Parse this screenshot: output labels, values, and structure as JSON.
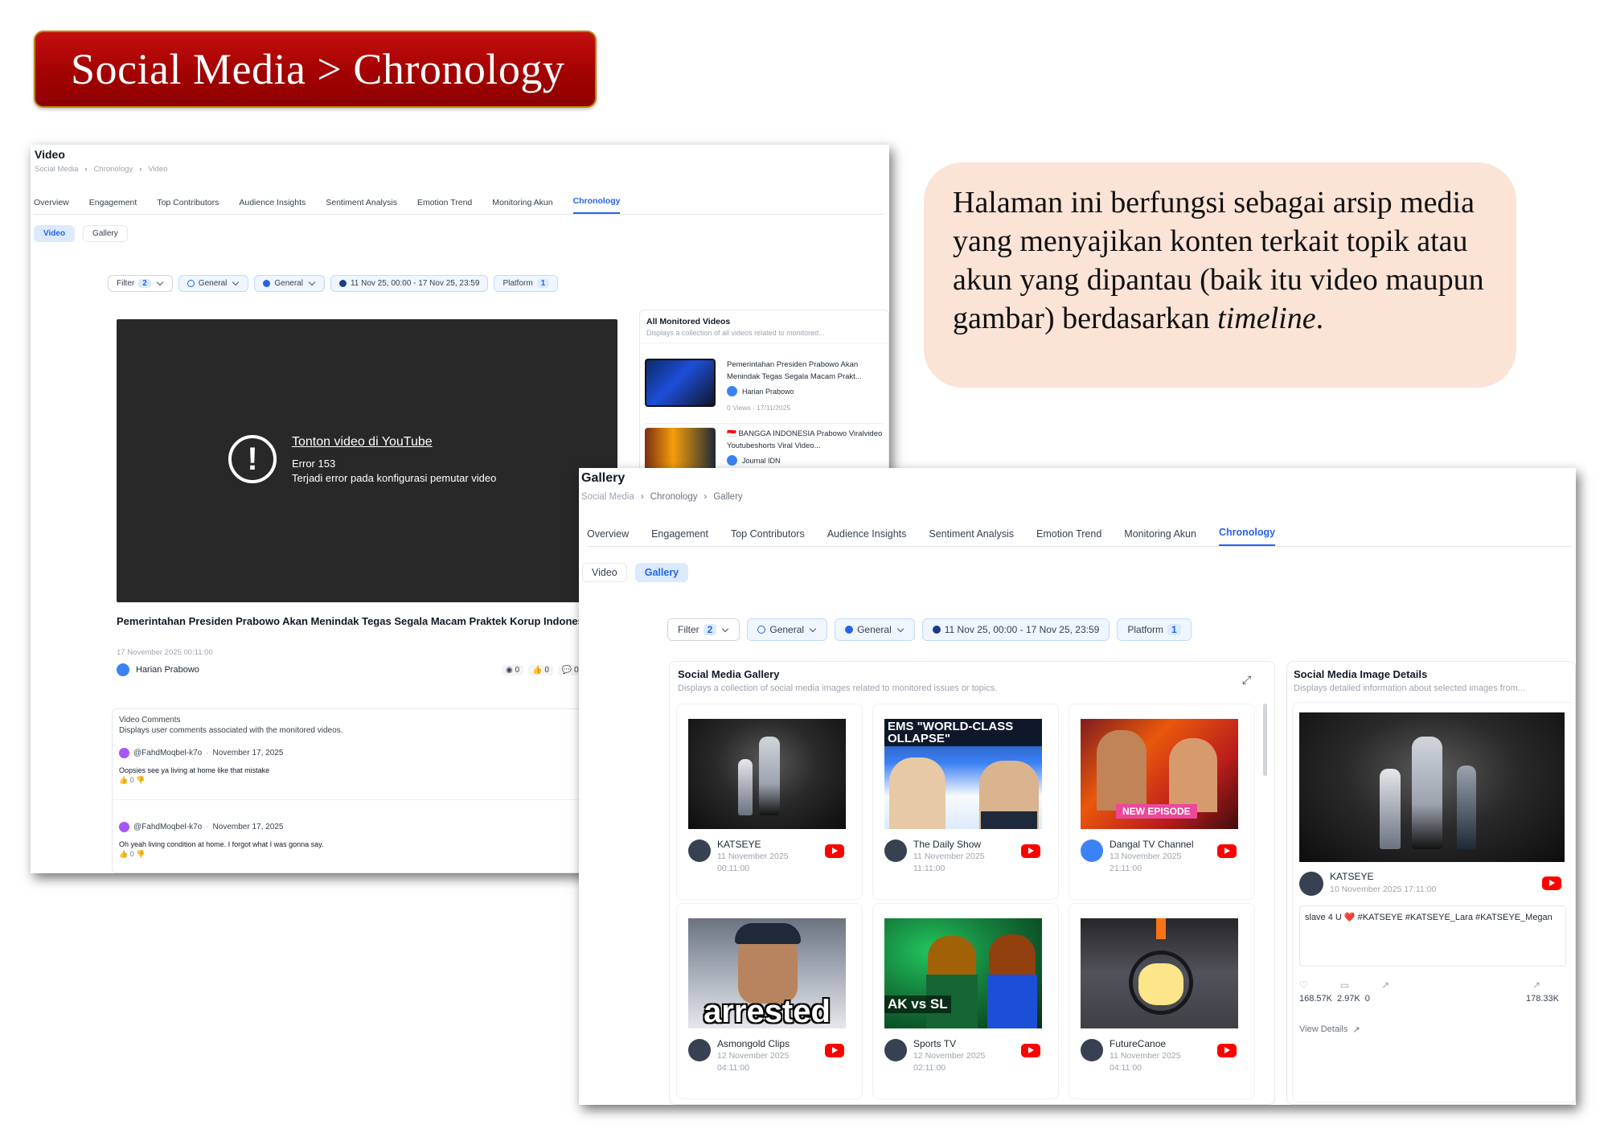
{
  "slide": {
    "title": "Social Media > Chronology",
    "description_main": "Halaman ini berfungsi sebagai arsip media yang menyajikan konten terkait topik atau akun yang dipantau (baik itu video maupun gambar) berdasarkan ",
    "description_italic": "timeline",
    "description_end": "."
  },
  "video_page": {
    "title": "Video",
    "breadcrumb": [
      "Social Media",
      "Chronology",
      "Video"
    ],
    "tabs": [
      "Overview",
      "Engagement",
      "Top Contributors",
      "Audience Insights",
      "Sentiment Analysis",
      "Emotion Trend",
      "Monitoring Akun",
      "Chronology"
    ],
    "subtabs": [
      "Video",
      "Gallery"
    ],
    "filters": {
      "filter_label": "Filter",
      "filter_count": "2",
      "general_1": "General",
      "general_2": "General",
      "date_range": "11 Nov 25, 00:00 - 17 Nov 25, 23:59",
      "platform_label": "Platform",
      "platform_count": "1"
    },
    "player": {
      "link": "Tonton video di YouTube",
      "error_code": "Error 153",
      "error_msg": "Terjadi error pada konfigurasi pemutar video"
    },
    "video_title": "Pemerintahan Presiden Prabowo Akan Menindak Tegas Segala Macam Praktek Korup Indonesia",
    "video_date": "17 November 2025 00:11:00",
    "video_channel": "Harian Prabowo",
    "video_stats": {
      "views": "0",
      "likes": "0",
      "dislikes": "0"
    },
    "list": {
      "title": "All Monitored Videos",
      "subtitle": "Displays a collection of all videos related to monitored...",
      "items": [
        {
          "title": "Pemerintahan Presiden Prabowo Akan Menindak Tegas Segala Macam Prakt...",
          "channel": "Harian Prabowo",
          "stats": "0 Views · 17/11/2025"
        },
        {
          "title": "🇮🇩 BANGGA INDONESIA Prabowo Viralvideo Youtubeshorts Viral Video...",
          "channel": "Journal IDN",
          "stats": ""
        }
      ]
    },
    "comments": {
      "title": "Video Comments",
      "subtitle": "Displays user comments associated with the monitored videos.",
      "items": [
        {
          "user": "@FahdMoqbel-k7o",
          "date": "November 17, 2025",
          "text": "Oopsies see ya living at home like that mistake",
          "likes": "0"
        },
        {
          "user": "@FahdMoqbel-k7o",
          "date": "November 17, 2025",
          "text": "Oh yeah living condition at home. I forgot what I was gonna say.",
          "likes": "0"
        }
      ]
    }
  },
  "gallery_page": {
    "title": "Gallery",
    "breadcrumb": [
      "Social Media",
      "Chronology",
      "Gallery"
    ],
    "tabs": [
      "Overview",
      "Engagement",
      "Top Contributors",
      "Audience Insights",
      "Sentiment Analysis",
      "Emotion Trend",
      "Monitoring Akun",
      "Chronology"
    ],
    "subtabs": [
      "Video",
      "Gallery"
    ],
    "filters": {
      "filter_label": "Filter",
      "filter_count": "2",
      "general_1": "General",
      "general_2": "General",
      "date_range": "11 Nov 25, 00:00 - 17 Nov 25, 23:59",
      "platform_label": "Platform",
      "platform_count": "1"
    },
    "gallery": {
      "title": "Social Media Gallery",
      "subtitle": "Displays a collection of social media images related to monitored issues or topics.",
      "cards": [
        {
          "name": "KATSEYE",
          "date": "11 November 2025",
          "time": "00:11:00",
          "thumb_text": ""
        },
        {
          "name": "The Daily Show",
          "date": "11 November 2025",
          "time": "11:11:00",
          "thumb_text": "EMS \"WORLD-CLASS\nOLLAPSE\""
        },
        {
          "name": "Dangal TV Channel",
          "date": "13 November 2025",
          "time": "21:11:00",
          "thumb_text": "NEW EPISODE"
        },
        {
          "name": "Asmongold Clips",
          "date": "12 November 2025",
          "time": "04:11:00",
          "thumb_text": "arrested"
        },
        {
          "name": "Sports TV",
          "date": "12 November 2025",
          "time": "02:11:00",
          "thumb_text": "AK vs SL"
        },
        {
          "name": "FutureCanoe",
          "date": "11 November 2025",
          "time": "04:11:00",
          "thumb_text": ""
        }
      ]
    },
    "details": {
      "title": "Social Media Image Details",
      "subtitle": "Displays detailed information about selected images from...",
      "name": "KATSEYE",
      "date": "10 November 2025 17:11:00",
      "caption": "slave 4 U ❤️ #KATSEYE #KATSEYE_Lara #KATSEYE_Megan",
      "likes": "168.57K",
      "comments": "2.97K",
      "shares": "0",
      "trend": "178.33K",
      "view_details": "View Details"
    }
  },
  "colors": {
    "accent": "#2563eb",
    "banner": "#a30202",
    "callout": "#fbe3d6",
    "youtube": "#ff0000"
  }
}
